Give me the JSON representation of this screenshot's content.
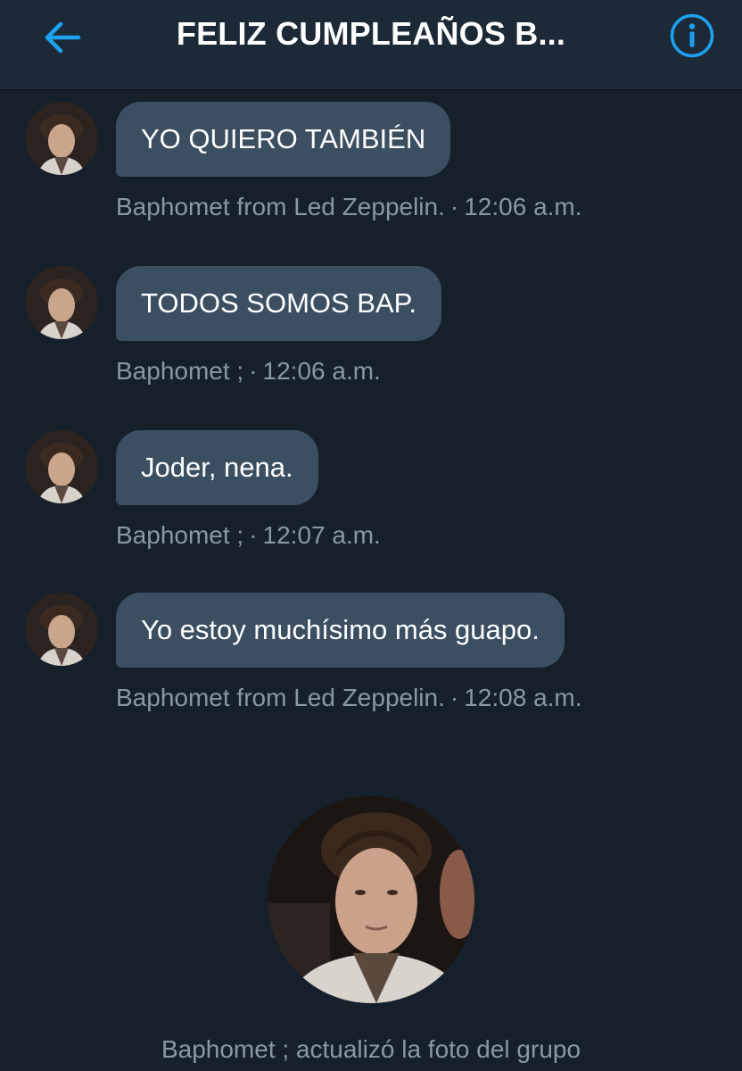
{
  "header": {
    "title": "FELIZ CUMPLEAÑOS B...",
    "back_icon": "arrow-left-icon",
    "info_icon": "info-circle-icon",
    "accent_color": "#1da1f2"
  },
  "messages": [
    {
      "text": "YO QUIERO TAMBIÉN",
      "sender": "Baphomet from Led Zeppelin.",
      "time": "12:06 a.m."
    },
    {
      "text": "TODOS SOMOS BAP.",
      "sender": "Baphomet ;",
      "time": "12:06 a.m."
    },
    {
      "text": "Joder, nena.",
      "sender": "Baphomet ;",
      "time": "12:07 a.m."
    },
    {
      "text": "Yo estoy muchísimo más guapo.",
      "sender": "Baphomet from Led Zeppelin.",
      "time": "12:08 a.m."
    }
  ],
  "meta_separator": "·",
  "system_note": "Baphomet ; actualizó la foto del grupo",
  "colors": {
    "background": "#15202b",
    "header_background": "#1c2a38",
    "bubble": "#3c4f61",
    "muted_text": "#8899a6"
  }
}
